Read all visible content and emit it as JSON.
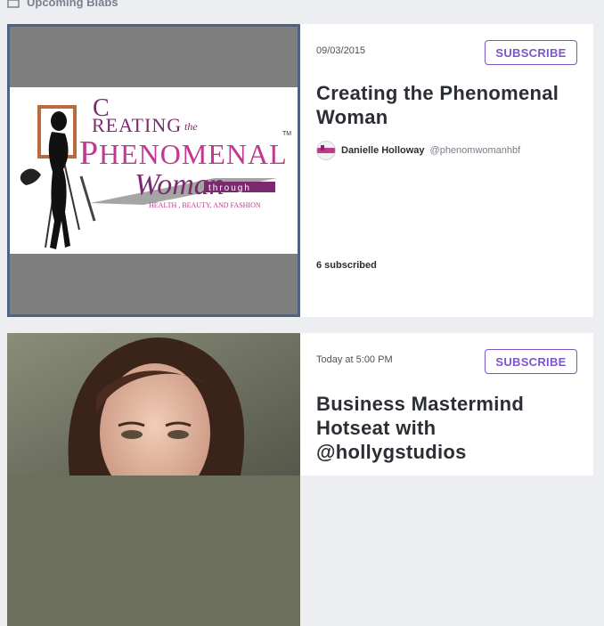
{
  "section": {
    "title": "Upcoming Blabs",
    "icon": "calendar-icon"
  },
  "colors": {
    "accent": "#7a56c7",
    "selected_border": "#4a6387"
  },
  "blabs": [
    {
      "date": "09/03/2015",
      "subscribe_label": "SUBSCRIBE",
      "title": "Creating the Phenomenal Woman",
      "host_name": "Danielle Holloway",
      "host_handle": "@phenomwomanhbf",
      "subscribed": "6 subscribed",
      "logo": {
        "line1": "REATING",
        "line1_the": "the",
        "line2": "HENOMENAL",
        "tm": "TM",
        "script": "Woman",
        "through": "through",
        "tagline": "HEALTH , BEAUTY, AND FASHION"
      }
    },
    {
      "date": "Today at 5:00 PM",
      "subscribe_label": "SUBSCRIBE",
      "title": "Business Mastermind Hotseat with @hollygstudios"
    }
  ]
}
